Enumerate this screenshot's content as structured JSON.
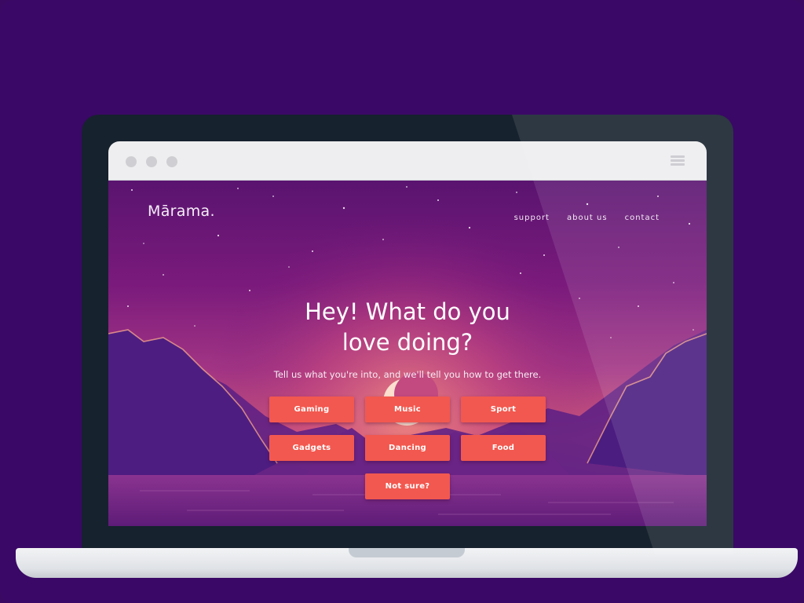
{
  "app": {
    "logo": "Mārama.",
    "nav": [
      "support",
      "about us",
      "contact"
    ]
  },
  "hero": {
    "title_line1": "Hey! What do you",
    "title_line2": "love doing?",
    "subtitle": "Tell us what you're into, and we'll tell you how to get there."
  },
  "buttons": {
    "gaming": "Gaming",
    "music": "Music",
    "sport": "Sport",
    "gadgets": "Gadgets",
    "dancing": "Dancing",
    "food": "Food",
    "not_sure": "Not sure?"
  },
  "browser": {
    "window_controls": [
      "dot",
      "dot",
      "dot"
    ],
    "menu_icon": "hamburger-icon"
  },
  "colors": {
    "background": "#3a0866",
    "laptop_bezel": "#16222e",
    "button": "#f2584f",
    "sky_top": "#5a1470",
    "sky_glow": "#d4607a"
  }
}
